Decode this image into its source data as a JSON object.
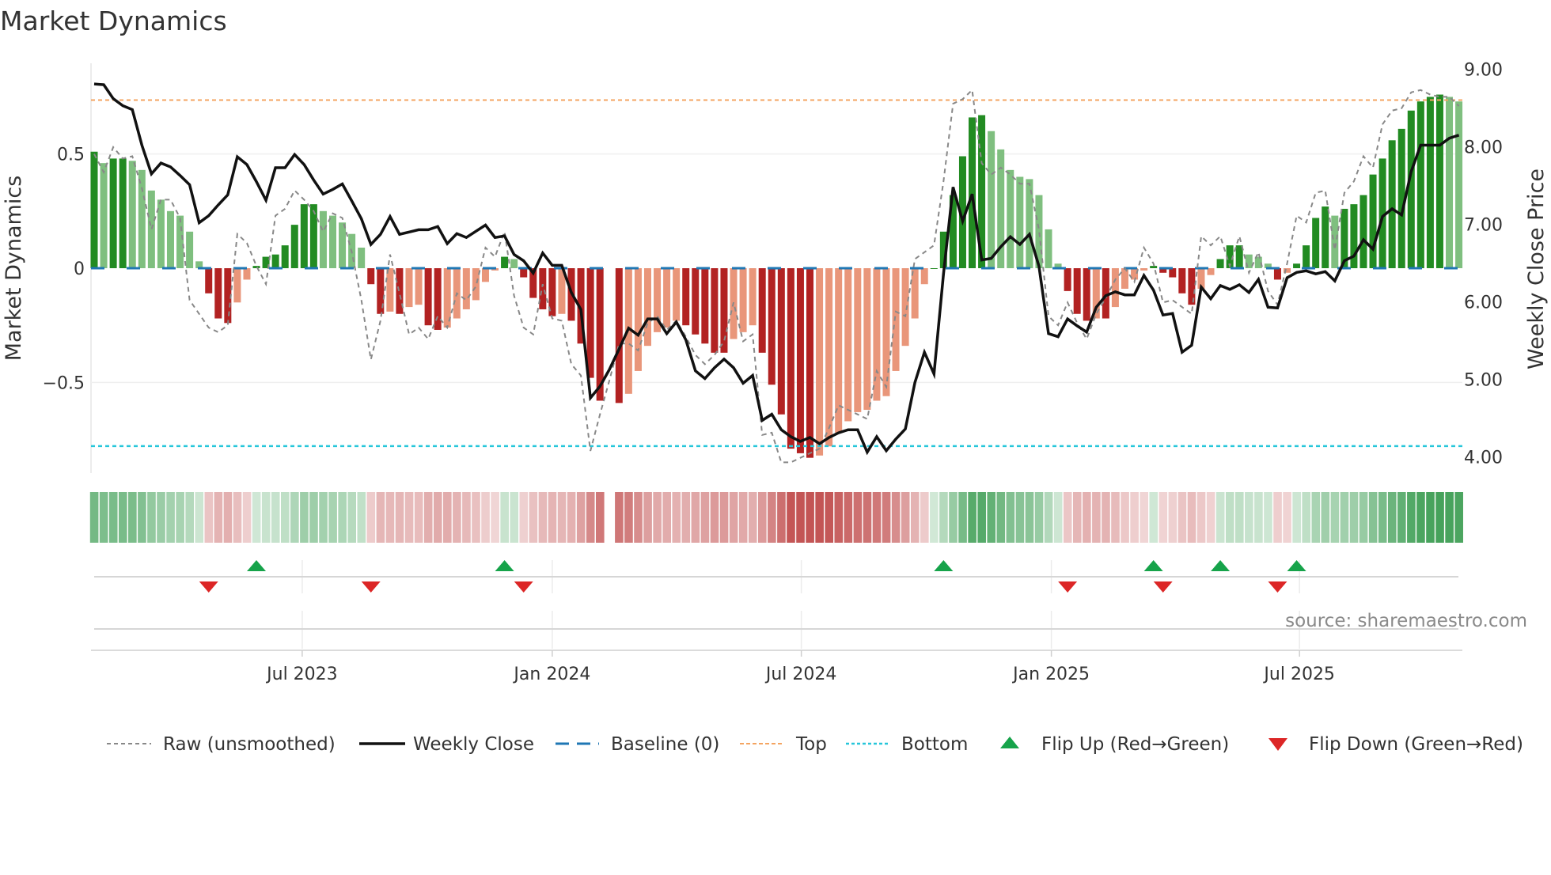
{
  "title": "Market Dynamics",
  "colors": {
    "up_strong": "#228B22",
    "up_weak": "#7FBF7F",
    "down_strong": "#B22222",
    "down_weak": "#E9967A",
    "close": "#111111",
    "raw": "#888888",
    "baseline": "#1F77B4",
    "top": "#F4A460",
    "bottom": "#26C6DA",
    "flip_up": "#16A34A",
    "flip_down": "#DC2626"
  },
  "source": "source: sharemaestro.com",
  "chart_data": {
    "type": "bar",
    "title": "Market Dynamics",
    "ylabel": "Market Dynamics",
    "y2label": "Weekly Close Price",
    "frequency": "weekly",
    "ylim": [
      -0.9,
      0.9
    ],
    "y2lim": [
      3.9,
      9.0
    ],
    "yticks": [
      {
        "v": 0.5,
        "label": "0.5"
      },
      {
        "v": 0,
        "label": "0"
      },
      {
        "v": -0.5,
        "label": "−0.5"
      }
    ],
    "y2ticks": [
      {
        "v": 9,
        "label": "9.00"
      },
      {
        "v": 8,
        "label": "8.00"
      },
      {
        "v": 7,
        "label": "7.00"
      },
      {
        "v": 6,
        "label": "6.00"
      },
      {
        "v": 5,
        "label": "5.00"
      },
      {
        "v": 4,
        "label": "4.00"
      }
    ],
    "xticks": [
      {
        "week": 22.8,
        "label": "Jul 2023"
      },
      {
        "week": 49.0,
        "label": "Jan 2024"
      },
      {
        "week": 75.1,
        "label": "Jul 2024"
      },
      {
        "week": 101.3,
        "label": "Jan 2025"
      },
      {
        "week": 127.3,
        "label": "Jul 2025"
      }
    ],
    "top_level": 0.736,
    "bottom_level": -0.779,
    "baseline": 0,
    "smoothed": [
      0.51,
      0.46,
      0.48,
      0.48,
      0.47,
      0.43,
      0.34,
      0.3,
      0.25,
      0.23,
      0.16,
      0.03,
      -0.11,
      -0.22,
      -0.24,
      -0.15,
      -0.05,
      0.01,
      0.05,
      0.06,
      0.1,
      0.19,
      0.28,
      0.28,
      0.25,
      0.23,
      0.2,
      0.15,
      0.09,
      -0.07,
      -0.2,
      -0.19,
      -0.2,
      -0.17,
      -0.16,
      -0.25,
      -0.27,
      -0.26,
      -0.22,
      -0.18,
      -0.14,
      -0.06,
      -0.01,
      0.05,
      0.04,
      -0.04,
      -0.13,
      -0.18,
      -0.21,
      -0.2,
      -0.23,
      -0.33,
      -0.48,
      -0.58,
      null,
      -0.59,
      -0.55,
      -0.45,
      -0.34,
      -0.28,
      -0.26,
      -0.23,
      -0.25,
      -0.29,
      -0.33,
      -0.37,
      -0.37,
      -0.31,
      -0.28,
      -0.25,
      -0.37,
      -0.51,
      -0.64,
      -0.79,
      -0.81,
      -0.83,
      -0.82,
      -0.78,
      -0.72,
      -0.67,
      -0.63,
      -0.62,
      -0.58,
      -0.56,
      -0.45,
      -0.34,
      -0.22,
      -0.07,
      0.0,
      0.16,
      0.32,
      0.49,
      0.66,
      0.67,
      0.6,
      0.52,
      0.43,
      0.4,
      0.39,
      0.32,
      0.17,
      0.02,
      -0.1,
      -0.2,
      -0.23,
      -0.22,
      -0.22,
      -0.17,
      -0.09,
      -0.05,
      -0.01,
      0.01,
      -0.02,
      -0.04,
      -0.11,
      -0.16,
      -0.09,
      -0.03,
      0.04,
      0.1,
      0.1,
      0.06,
      0.05,
      0.02,
      -0.05,
      -0.02,
      0.02,
      0.1,
      0.22,
      0.27,
      0.23,
      0.26,
      0.28,
      0.32,
      0.41,
      0.48,
      0.56,
      0.61,
      0.69,
      0.73,
      0.75,
      0.76,
      0.75,
      0.73
    ],
    "raw": [
      0.5,
      0.42,
      0.53,
      0.48,
      0.49,
      0.35,
      0.17,
      0.3,
      0.3,
      0.22,
      -0.14,
      -0.2,
      -0.26,
      -0.28,
      -0.25,
      0.15,
      0.11,
      0.01,
      -0.07,
      0.23,
      0.26,
      0.34,
      0.3,
      0.25,
      0.16,
      0.24,
      0.22,
      0.07,
      -0.14,
      -0.4,
      -0.23,
      0.06,
      -0.11,
      -0.29,
      -0.26,
      -0.31,
      -0.21,
      -0.26,
      -0.11,
      -0.14,
      -0.08,
      0.09,
      0.05,
      0.16,
      -0.12,
      -0.26,
      -0.29,
      -0.07,
      -0.22,
      -0.23,
      -0.42,
      -0.47,
      -0.8,
      -0.64,
      -0.49,
      -0.33,
      -0.33,
      -0.36,
      -0.24,
      -0.21,
      -0.27,
      -0.23,
      -0.3,
      -0.38,
      -0.42,
      -0.38,
      -0.32,
      -0.15,
      -0.32,
      -0.29,
      -0.73,
      -0.72,
      -0.85,
      -0.85,
      -0.83,
      -0.81,
      -0.79,
      -0.7,
      -0.6,
      -0.62,
      -0.64,
      -0.66,
      -0.45,
      -0.52,
      -0.19,
      -0.21,
      0.04,
      0.07,
      0.1,
      0.38,
      0.72,
      0.74,
      0.78,
      0.46,
      0.41,
      0.44,
      0.41,
      0.37,
      0.37,
      0.17,
      -0.21,
      -0.25,
      -0.15,
      -0.24,
      -0.31,
      -0.2,
      -0.13,
      -0.05,
      0.0,
      -0.06,
      0.09,
      0.02,
      -0.15,
      -0.14,
      -0.17,
      -0.2,
      0.14,
      0.1,
      0.14,
      0.01,
      0.14,
      -0.02,
      0.07,
      -0.1,
      -0.16,
      0.02,
      0.23,
      0.2,
      0.33,
      0.34,
      0.08,
      0.33,
      0.38,
      0.49,
      0.44,
      0.63,
      0.69,
      0.7,
      0.77,
      0.78,
      0.76,
      0.75,
      0.75,
      0.71
    ],
    "close": [
      8.81,
      8.8,
      8.62,
      8.53,
      8.48,
      8.02,
      7.65,
      7.79,
      7.74,
      7.63,
      7.51,
      7.02,
      7.11,
      7.25,
      7.38,
      7.87,
      7.77,
      7.55,
      7.31,
      7.73,
      7.73,
      7.9,
      7.77,
      7.57,
      7.39,
      7.45,
      7.52,
      7.3,
      7.07,
      6.74,
      6.87,
      7.1,
      6.87,
      6.9,
      6.93,
      6.93,
      6.97,
      6.75,
      6.88,
      6.83,
      6.91,
      6.99,
      6.83,
      6.85,
      6.61,
      6.53,
      6.37,
      6.63,
      6.47,
      6.47,
      6.12,
      5.9,
      4.76,
      4.91,
      5.13,
      5.39,
      5.66,
      5.57,
      5.78,
      5.78,
      5.59,
      5.74,
      5.51,
      5.11,
      5.01,
      5.15,
      5.26,
      5.15,
      4.95,
      5.05,
      4.47,
      4.55,
      4.35,
      4.26,
      4.2,
      4.25,
      4.17,
      4.25,
      4.31,
      4.35,
      4.35,
      4.06,
      4.26,
      4.08,
      4.23,
      4.36,
      4.96,
      5.35,
      5.07,
      6.36,
      7.48,
      7.04,
      7.39,
      6.54,
      6.56,
      6.71,
      6.84,
      6.74,
      6.87,
      6.46,
      5.59,
      5.55,
      5.78,
      5.69,
      5.61,
      5.93,
      6.08,
      6.13,
      6.09,
      6.09,
      6.34,
      6.15,
      5.83,
      5.85,
      5.35,
      5.44,
      6.19,
      6.04,
      6.21,
      6.16,
      6.22,
      6.12,
      6.29,
      5.93,
      5.92,
      6.31,
      6.38,
      6.4,
      6.36,
      6.39,
      6.27,
      6.53,
      6.59,
      6.8,
      6.68,
      7.1,
      7.2,
      7.12,
      7.68,
      8.02,
      8.02,
      8.02,
      8.11,
      8.15
    ],
    "flip_up_weeks": [
      18,
      44,
      90,
      112,
      119,
      127
    ],
    "flip_down_weeks": [
      13,
      30,
      46,
      103,
      113,
      125
    ],
    "legend": {
      "placement": "bottom",
      "raw": "Raw (unsmoothed)",
      "close": "Weekly Close",
      "baseline": "Baseline (0)",
      "top": "Top",
      "bottom": "Bottom",
      "flip_up": "Flip Up (Red→Green)",
      "flip_down": "Flip Down (Green→Red)"
    }
  }
}
